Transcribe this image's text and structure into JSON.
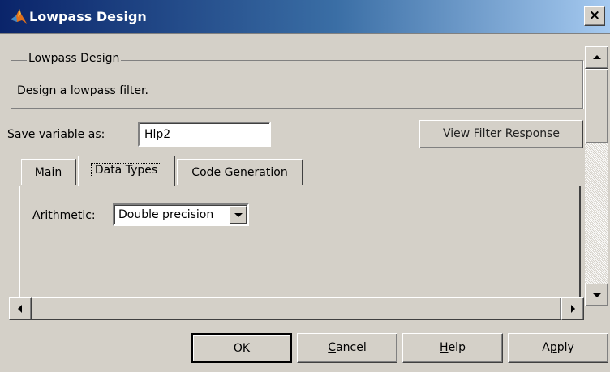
{
  "window": {
    "title": "Lowpass Design",
    "icon": "matlab-logo-icon",
    "close_label": "×"
  },
  "group": {
    "legend": "Lowpass Design",
    "description": "Design a lowpass filter."
  },
  "save": {
    "label": "Save variable as:",
    "value": "Hlp2"
  },
  "view_button": "View Filter Response",
  "tabs": [
    {
      "label": "Main"
    },
    {
      "label": "Data Types",
      "selected": true
    },
    {
      "label": "Code Generation"
    }
  ],
  "arithmetic": {
    "label": "Arithmetic:",
    "value": "Double precision"
  },
  "buttons": {
    "ok_mnemonic": "O",
    "ok_rest": "K",
    "cancel_mnemonic": "C",
    "cancel_rest": "ancel",
    "help_mnemonic": "H",
    "help_rest": "elp",
    "apply_first": "A",
    "apply_mnemonic": "p",
    "apply_rest": "ply"
  },
  "colors": {
    "title_gradient_start": "#0a246a",
    "title_gradient_end": "#a6caf0",
    "face": "#d4d0c8"
  }
}
